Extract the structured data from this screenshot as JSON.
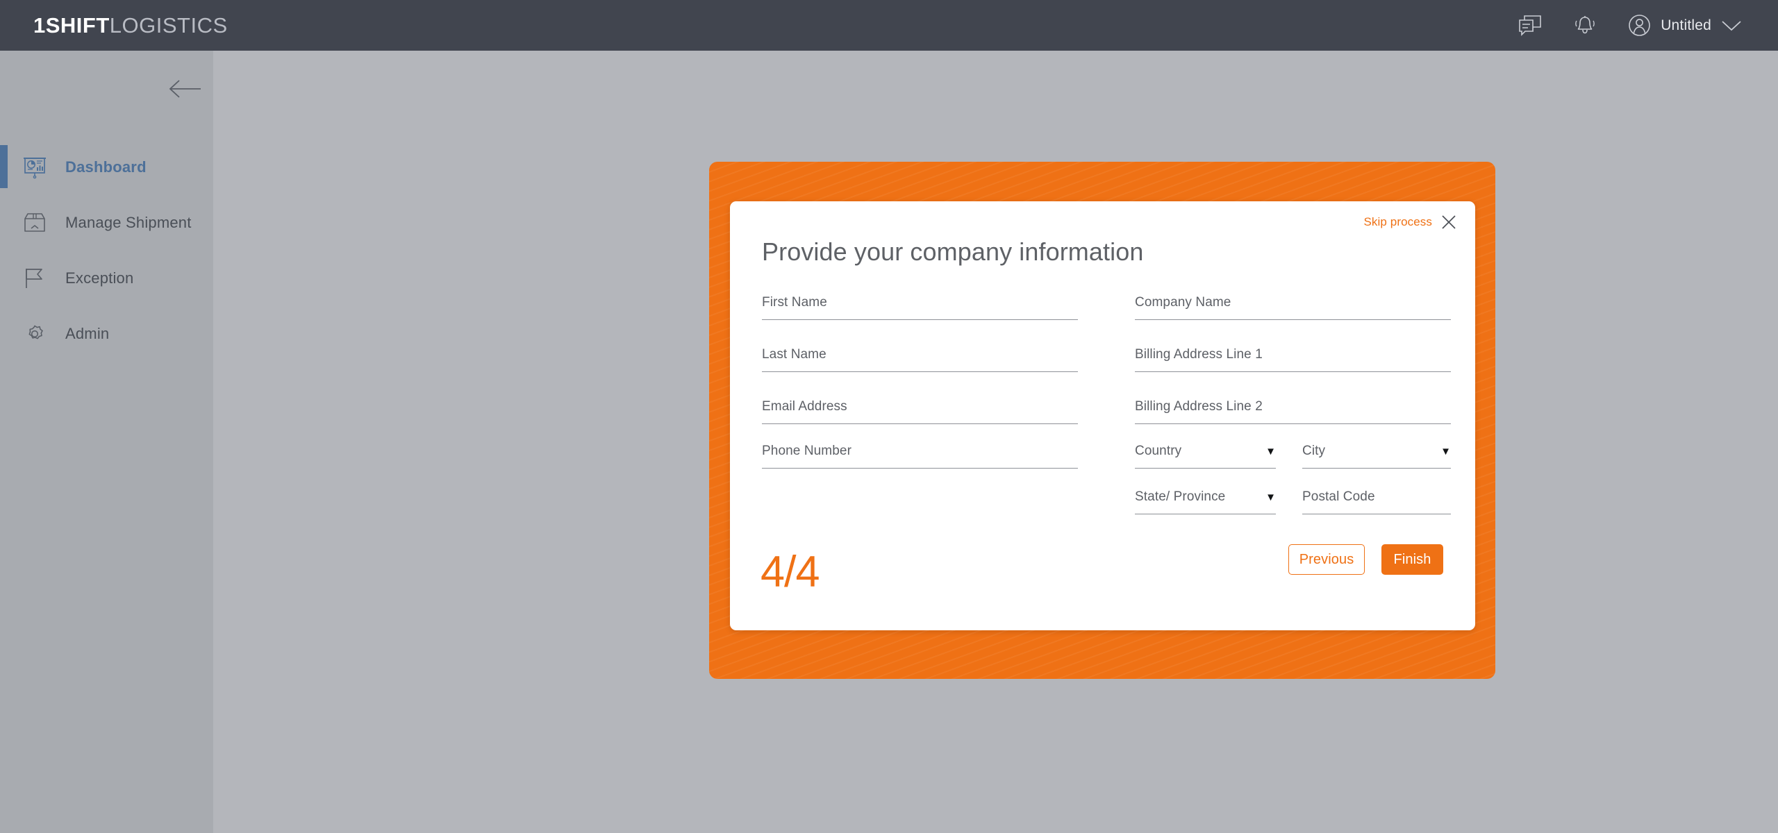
{
  "topbar": {
    "brand_bold": "1SHIFT",
    "brand_light": "LOGISTICS",
    "messages_icon": "chat-bubbles-icon",
    "notifications_icon": "bell-icon",
    "avatar_icon": "user-avatar-icon",
    "username": "Untitled",
    "chevron_icon": "chevron-down-icon",
    "background_color": "#41454f"
  },
  "sidebar": {
    "collapse_icon": "arrow-left-icon",
    "background_color": "#a8abb0",
    "active_accent_color": "#4d7099",
    "items": [
      {
        "label": "Dashboard",
        "icon": "presentation-chart-icon",
        "active": true
      },
      {
        "label": "Manage Shipment",
        "icon": "package-box-icon",
        "active": false
      },
      {
        "label": "Exception",
        "icon": "flag-icon",
        "active": false
      },
      {
        "label": "Admin",
        "icon": "gear-icon",
        "active": false
      }
    ]
  },
  "modal": {
    "frame_color": "#ef7115",
    "title": "Provide your company information",
    "skip_label": "Skip process",
    "close_icon": "close-x-icon",
    "step_counter": "4/4",
    "fields": {
      "first_name": {
        "placeholder": "First Name",
        "value": "",
        "type": "text"
      },
      "last_name": {
        "placeholder": "Last Name",
        "value": "",
        "type": "text"
      },
      "email": {
        "placeholder": "Email Address",
        "value": "",
        "type": "text"
      },
      "phone": {
        "placeholder": "Phone Number",
        "value": "",
        "type": "text"
      },
      "company_name": {
        "placeholder": "Company Name",
        "value": "",
        "type": "text"
      },
      "billing1": {
        "placeholder": "Billing Address Line 1",
        "value": "",
        "type": "text"
      },
      "billing2": {
        "placeholder": "Billing Address Line 2",
        "value": "",
        "type": "text"
      },
      "country": {
        "placeholder": "Country",
        "value": "",
        "type": "select",
        "caret": "▼"
      },
      "city": {
        "placeholder": "City",
        "value": "",
        "type": "select",
        "caret": "▼"
      },
      "state": {
        "placeholder": "State/ Province",
        "value": "",
        "type": "select",
        "caret": "▼"
      },
      "postal_code": {
        "placeholder": "Postal Code",
        "value": "",
        "type": "text"
      }
    },
    "buttons": {
      "previous": "Previous",
      "finish": "Finish"
    }
  }
}
